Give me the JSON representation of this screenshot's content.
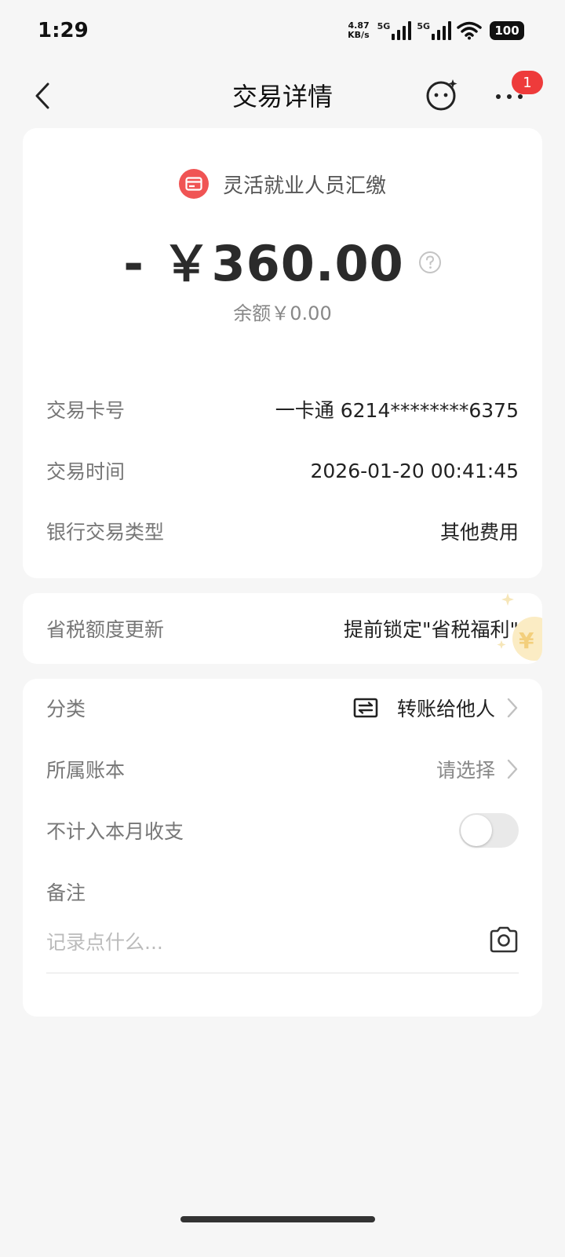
{
  "status_bar": {
    "time": "1:29",
    "net_speed_value": "4.87",
    "net_speed_unit": "KB/s",
    "signal_1_label": "5G",
    "signal_2_label": "5G",
    "battery": "100"
  },
  "nav": {
    "title": "交易详情",
    "more_badge": "1"
  },
  "transaction": {
    "merchant": "灵活就业人员汇缴",
    "amount": "- ￥360.00",
    "balance": "余额￥0.00",
    "details": [
      {
        "label": "交易卡号",
        "value": "一卡通 6214********6375"
      },
      {
        "label": "交易时间",
        "value": "2026-01-20 00:41:45"
      },
      {
        "label": "银行交易类型",
        "value": "其他费用"
      }
    ]
  },
  "tax": {
    "label": "省税额度更新",
    "value": "提前锁定\"省税福利\""
  },
  "settings": {
    "category_label": "分类",
    "category_value": "转账给他人",
    "book_label": "所属账本",
    "book_value": "请选择",
    "exclude_label": "不计入本月收支",
    "exclude_on": false,
    "note_label": "备注",
    "note_value": "",
    "note_placeholder": "记录点什么..."
  },
  "colors": {
    "accent_red": "#ee3b3b",
    "merchant_icon": "#f05454",
    "background": "#f6f6f6"
  }
}
